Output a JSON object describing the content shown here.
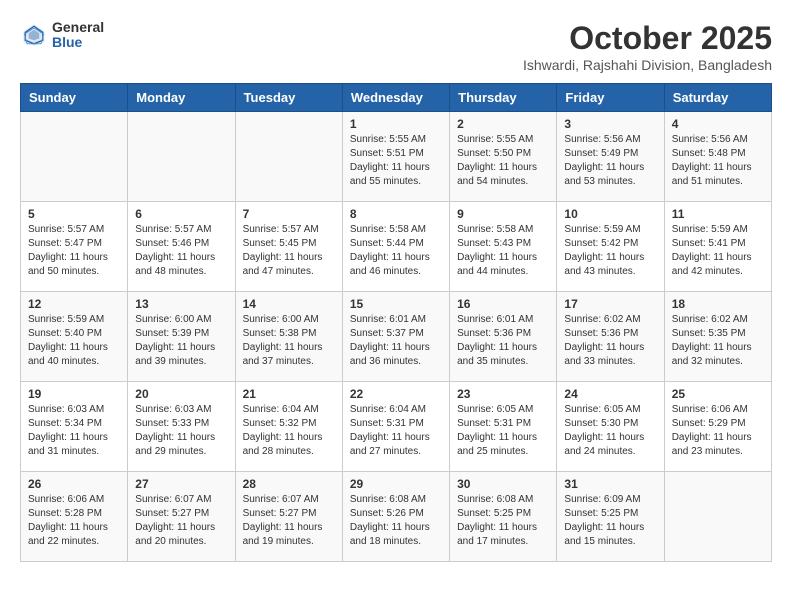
{
  "header": {
    "logo_general": "General",
    "logo_blue": "Blue",
    "month": "October 2025",
    "location": "Ishwardi, Rajshahi Division, Bangladesh"
  },
  "weekdays": [
    "Sunday",
    "Monday",
    "Tuesday",
    "Wednesday",
    "Thursday",
    "Friday",
    "Saturday"
  ],
  "weeks": [
    [
      {
        "day": "",
        "sunrise": "",
        "sunset": "",
        "daylight": ""
      },
      {
        "day": "",
        "sunrise": "",
        "sunset": "",
        "daylight": ""
      },
      {
        "day": "",
        "sunrise": "",
        "sunset": "",
        "daylight": ""
      },
      {
        "day": "1",
        "sunrise": "Sunrise: 5:55 AM",
        "sunset": "Sunset: 5:51 PM",
        "daylight": "Daylight: 11 hours and 55 minutes."
      },
      {
        "day": "2",
        "sunrise": "Sunrise: 5:55 AM",
        "sunset": "Sunset: 5:50 PM",
        "daylight": "Daylight: 11 hours and 54 minutes."
      },
      {
        "day": "3",
        "sunrise": "Sunrise: 5:56 AM",
        "sunset": "Sunset: 5:49 PM",
        "daylight": "Daylight: 11 hours and 53 minutes."
      },
      {
        "day": "4",
        "sunrise": "Sunrise: 5:56 AM",
        "sunset": "Sunset: 5:48 PM",
        "daylight": "Daylight: 11 hours and 51 minutes."
      }
    ],
    [
      {
        "day": "5",
        "sunrise": "Sunrise: 5:57 AM",
        "sunset": "Sunset: 5:47 PM",
        "daylight": "Daylight: 11 hours and 50 minutes."
      },
      {
        "day": "6",
        "sunrise": "Sunrise: 5:57 AM",
        "sunset": "Sunset: 5:46 PM",
        "daylight": "Daylight: 11 hours and 48 minutes."
      },
      {
        "day": "7",
        "sunrise": "Sunrise: 5:57 AM",
        "sunset": "Sunset: 5:45 PM",
        "daylight": "Daylight: 11 hours and 47 minutes."
      },
      {
        "day": "8",
        "sunrise": "Sunrise: 5:58 AM",
        "sunset": "Sunset: 5:44 PM",
        "daylight": "Daylight: 11 hours and 46 minutes."
      },
      {
        "day": "9",
        "sunrise": "Sunrise: 5:58 AM",
        "sunset": "Sunset: 5:43 PM",
        "daylight": "Daylight: 11 hours and 44 minutes."
      },
      {
        "day": "10",
        "sunrise": "Sunrise: 5:59 AM",
        "sunset": "Sunset: 5:42 PM",
        "daylight": "Daylight: 11 hours and 43 minutes."
      },
      {
        "day": "11",
        "sunrise": "Sunrise: 5:59 AM",
        "sunset": "Sunset: 5:41 PM",
        "daylight": "Daylight: 11 hours and 42 minutes."
      }
    ],
    [
      {
        "day": "12",
        "sunrise": "Sunrise: 5:59 AM",
        "sunset": "Sunset: 5:40 PM",
        "daylight": "Daylight: 11 hours and 40 minutes."
      },
      {
        "day": "13",
        "sunrise": "Sunrise: 6:00 AM",
        "sunset": "Sunset: 5:39 PM",
        "daylight": "Daylight: 11 hours and 39 minutes."
      },
      {
        "day": "14",
        "sunrise": "Sunrise: 6:00 AM",
        "sunset": "Sunset: 5:38 PM",
        "daylight": "Daylight: 11 hours and 37 minutes."
      },
      {
        "day": "15",
        "sunrise": "Sunrise: 6:01 AM",
        "sunset": "Sunset: 5:37 PM",
        "daylight": "Daylight: 11 hours and 36 minutes."
      },
      {
        "day": "16",
        "sunrise": "Sunrise: 6:01 AM",
        "sunset": "Sunset: 5:36 PM",
        "daylight": "Daylight: 11 hours and 35 minutes."
      },
      {
        "day": "17",
        "sunrise": "Sunrise: 6:02 AM",
        "sunset": "Sunset: 5:36 PM",
        "daylight": "Daylight: 11 hours and 33 minutes."
      },
      {
        "day": "18",
        "sunrise": "Sunrise: 6:02 AM",
        "sunset": "Sunset: 5:35 PM",
        "daylight": "Daylight: 11 hours and 32 minutes."
      }
    ],
    [
      {
        "day": "19",
        "sunrise": "Sunrise: 6:03 AM",
        "sunset": "Sunset: 5:34 PM",
        "daylight": "Daylight: 11 hours and 31 minutes."
      },
      {
        "day": "20",
        "sunrise": "Sunrise: 6:03 AM",
        "sunset": "Sunset: 5:33 PM",
        "daylight": "Daylight: 11 hours and 29 minutes."
      },
      {
        "day": "21",
        "sunrise": "Sunrise: 6:04 AM",
        "sunset": "Sunset: 5:32 PM",
        "daylight": "Daylight: 11 hours and 28 minutes."
      },
      {
        "day": "22",
        "sunrise": "Sunrise: 6:04 AM",
        "sunset": "Sunset: 5:31 PM",
        "daylight": "Daylight: 11 hours and 27 minutes."
      },
      {
        "day": "23",
        "sunrise": "Sunrise: 6:05 AM",
        "sunset": "Sunset: 5:31 PM",
        "daylight": "Daylight: 11 hours and 25 minutes."
      },
      {
        "day": "24",
        "sunrise": "Sunrise: 6:05 AM",
        "sunset": "Sunset: 5:30 PM",
        "daylight": "Daylight: 11 hours and 24 minutes."
      },
      {
        "day": "25",
        "sunrise": "Sunrise: 6:06 AM",
        "sunset": "Sunset: 5:29 PM",
        "daylight": "Daylight: 11 hours and 23 minutes."
      }
    ],
    [
      {
        "day": "26",
        "sunrise": "Sunrise: 6:06 AM",
        "sunset": "Sunset: 5:28 PM",
        "daylight": "Daylight: 11 hours and 22 minutes."
      },
      {
        "day": "27",
        "sunrise": "Sunrise: 6:07 AM",
        "sunset": "Sunset: 5:27 PM",
        "daylight": "Daylight: 11 hours and 20 minutes."
      },
      {
        "day": "28",
        "sunrise": "Sunrise: 6:07 AM",
        "sunset": "Sunset: 5:27 PM",
        "daylight": "Daylight: 11 hours and 19 minutes."
      },
      {
        "day": "29",
        "sunrise": "Sunrise: 6:08 AM",
        "sunset": "Sunset: 5:26 PM",
        "daylight": "Daylight: 11 hours and 18 minutes."
      },
      {
        "day": "30",
        "sunrise": "Sunrise: 6:08 AM",
        "sunset": "Sunset: 5:25 PM",
        "daylight": "Daylight: 11 hours and 17 minutes."
      },
      {
        "day": "31",
        "sunrise": "Sunrise: 6:09 AM",
        "sunset": "Sunset: 5:25 PM",
        "daylight": "Daylight: 11 hours and 15 minutes."
      },
      {
        "day": "",
        "sunrise": "",
        "sunset": "",
        "daylight": ""
      }
    ]
  ]
}
